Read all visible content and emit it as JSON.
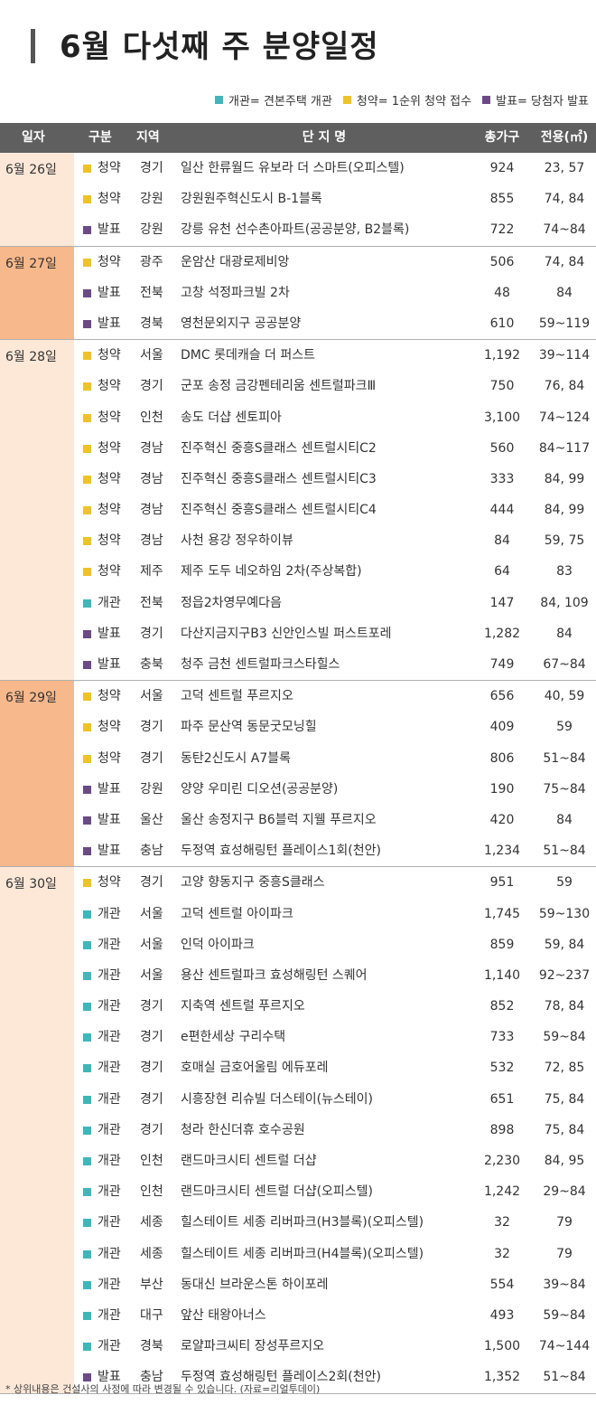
{
  "title": "6월 다섯째 주 분양일정",
  "colors": {
    "open": "#3fb6b9",
    "sub": "#f0c12a",
    "ann": "#6b4a85"
  },
  "legend": [
    {
      "kind": "open",
      "label": "개관= 견본주택 개관"
    },
    {
      "kind": "sub",
      "label": "청약= 1순위 청약 접수"
    },
    {
      "kind": "ann",
      "label": "발표= 당첨자 발표"
    }
  ],
  "headers": {
    "date": "일자",
    "type": "구분",
    "region": "지역",
    "name": "단  지  명",
    "units": "총가구",
    "area": "전용(㎡)"
  },
  "groups": [
    {
      "date": "6월 26일",
      "rows": [
        {
          "kind": "sub",
          "type": "청약",
          "region": "경기",
          "name": "일산 한류월드 유보라 더 스마트(오피스텔)",
          "units": "924",
          "area": "23, 57"
        },
        {
          "kind": "sub",
          "type": "청약",
          "region": "강원",
          "name": "강원원주혁신도시 B-1블록",
          "units": "855",
          "area": "74, 84"
        },
        {
          "kind": "ann",
          "type": "발표",
          "region": "강원",
          "name": "강릉 유천 선수촌아파트(공공분양, B2블록)",
          "units": "722",
          "area": "74~84"
        }
      ]
    },
    {
      "date": "6월 27일",
      "rows": [
        {
          "kind": "sub",
          "type": "청약",
          "region": "광주",
          "name": "운암산 대광로제비앙",
          "units": "506",
          "area": "74, 84"
        },
        {
          "kind": "ann",
          "type": "발표",
          "region": "전북",
          "name": "고창 석정파크빌 2차",
          "units": "48",
          "area": "84"
        },
        {
          "kind": "ann",
          "type": "발표",
          "region": "경북",
          "name": "영천문외지구 공공분양",
          "units": "610",
          "area": "59~119"
        }
      ]
    },
    {
      "date": "6월 28일",
      "rows": [
        {
          "kind": "sub",
          "type": "청약",
          "region": "서울",
          "name": "DMC 롯데캐슬 더 퍼스트",
          "units": "1,192",
          "area": "39~114"
        },
        {
          "kind": "sub",
          "type": "청약",
          "region": "경기",
          "name": "군포 송정 금강펜테리움 센트럴파크Ⅲ",
          "units": "750",
          "area": "76, 84"
        },
        {
          "kind": "sub",
          "type": "청약",
          "region": "인천",
          "name": "송도 더샵 센토피아",
          "units": "3,100",
          "area": "74~124"
        },
        {
          "kind": "sub",
          "type": "청약",
          "region": "경남",
          "name": "진주혁신 중흥S클래스 센트럴시티C2",
          "units": "560",
          "area": "84~117"
        },
        {
          "kind": "sub",
          "type": "청약",
          "region": "경남",
          "name": "진주혁신 중흥S클래스 센트럴시티C3",
          "units": "333",
          "area": "84, 99"
        },
        {
          "kind": "sub",
          "type": "청약",
          "region": "경남",
          "name": "진주혁신 중흥S클래스 센트럴시티C4",
          "units": "444",
          "area": "84, 99"
        },
        {
          "kind": "sub",
          "type": "청약",
          "region": "경남",
          "name": "사천 용강 정우하이뷰",
          "units": "84",
          "area": "59, 75"
        },
        {
          "kind": "sub",
          "type": "청약",
          "region": "제주",
          "name": "제주 도두 네오하임 2차(주상복합)",
          "units": "64",
          "area": "83"
        },
        {
          "kind": "open",
          "type": "개관",
          "region": "전북",
          "name": "정읍2차영무예다음",
          "units": "147",
          "area": "84, 109"
        },
        {
          "kind": "ann",
          "type": "발표",
          "region": "경기",
          "name": "다산지금지구B3 신안인스빌 퍼스트포레",
          "units": "1,282",
          "area": "84"
        },
        {
          "kind": "ann",
          "type": "발표",
          "region": "충북",
          "name": "청주 금천 센트럴파크스타힐스",
          "units": "749",
          "area": "67~84"
        }
      ]
    },
    {
      "date": "6월 29일",
      "rows": [
        {
          "kind": "sub",
          "type": "청약",
          "region": "서울",
          "name": "고덕 센트럴 푸르지오",
          "units": "656",
          "area": "40, 59"
        },
        {
          "kind": "sub",
          "type": "청약",
          "region": "경기",
          "name": "파주 문산역 동문굿모닝힐",
          "units": "409",
          "area": "59"
        },
        {
          "kind": "sub",
          "type": "청약",
          "region": "경기",
          "name": "동탄2신도시 A7블록",
          "units": "806",
          "area": "51~84"
        },
        {
          "kind": "ann",
          "type": "발표",
          "region": "강원",
          "name": "양양 우미린 디오션(공공분양)",
          "units": "190",
          "area": "75~84"
        },
        {
          "kind": "ann",
          "type": "발표",
          "region": "울산",
          "name": "울산 송정지구 B6블럭 지웰 푸르지오",
          "units": "420",
          "area": "84"
        },
        {
          "kind": "ann",
          "type": "발표",
          "region": "충남",
          "name": "두정역 효성해링턴 플레이스1회(천안)",
          "units": "1,234",
          "area": "51~84"
        }
      ]
    },
    {
      "date": "6월 30일",
      "rows": [
        {
          "kind": "sub",
          "type": "청약",
          "region": "경기",
          "name": "고양 향동지구 중흥S클래스",
          "units": "951",
          "area": "59"
        },
        {
          "kind": "open",
          "type": "개관",
          "region": "서울",
          "name": "고덕 센트럴 아이파크",
          "units": "1,745",
          "area": "59~130"
        },
        {
          "kind": "open",
          "type": "개관",
          "region": "서울",
          "name": "인덕 아이파크",
          "units": "859",
          "area": "59, 84"
        },
        {
          "kind": "open",
          "type": "개관",
          "region": "서울",
          "name": "용산 센트럴파크 효성해링턴 스퀘어",
          "units": "1,140",
          "area": "92~237"
        },
        {
          "kind": "open",
          "type": "개관",
          "region": "경기",
          "name": "지축역 센트럴 푸르지오",
          "units": "852",
          "area": "78, 84"
        },
        {
          "kind": "open",
          "type": "개관",
          "region": "경기",
          "name": "e편한세상 구리수택",
          "units": "733",
          "area": "59~84"
        },
        {
          "kind": "open",
          "type": "개관",
          "region": "경기",
          "name": "호매실 금호어울림 에듀포레",
          "units": "532",
          "area": "72, 85"
        },
        {
          "kind": "open",
          "type": "개관",
          "region": "경기",
          "name": "시흥장현 리슈빌 더스테이(뉴스테이)",
          "units": "651",
          "area": "75, 84"
        },
        {
          "kind": "open",
          "type": "개관",
          "region": "경기",
          "name": "청라 한신더휴 호수공원",
          "units": "898",
          "area": "75, 84"
        },
        {
          "kind": "open",
          "type": "개관",
          "region": "인천",
          "name": "랜드마크시티 센트럴 더샵",
          "units": "2,230",
          "area": "84, 95"
        },
        {
          "kind": "open",
          "type": "개관",
          "region": "인천",
          "name": "랜드마크시티 센트럴 더샵(오피스텔)",
          "units": "1,242",
          "area": "29~84"
        },
        {
          "kind": "open",
          "type": "개관",
          "region": "세종",
          "name": "힐스테이트 세종 리버파크(H3블록)(오피스텔)",
          "units": "32",
          "area": "79"
        },
        {
          "kind": "open",
          "type": "개관",
          "region": "세종",
          "name": "힐스테이트 세종 리버파크(H4블록)(오피스텔)",
          "units": "32",
          "area": "79"
        },
        {
          "kind": "open",
          "type": "개관",
          "region": "부산",
          "name": "동대신 브라운스톤 하이포레",
          "units": "554",
          "area": "39~84"
        },
        {
          "kind": "open",
          "type": "개관",
          "region": "대구",
          "name": "앞산 태왕아너스",
          "units": "493",
          "area": "59~84"
        },
        {
          "kind": "open",
          "type": "개관",
          "region": "경북",
          "name": "로얄파크씨티 장성푸르지오",
          "units": "1,500",
          "area": "74~144"
        },
        {
          "kind": "ann",
          "type": "발표",
          "region": "충남",
          "name": "두정역 효성해링턴 플레이스2회(천안)",
          "units": "1,352",
          "area": "51~84"
        }
      ]
    }
  ],
  "footnote": "* 상위내용은 건설사의 사정에 따라 변경될 수 있습니다. (자료=리얼투데이)"
}
